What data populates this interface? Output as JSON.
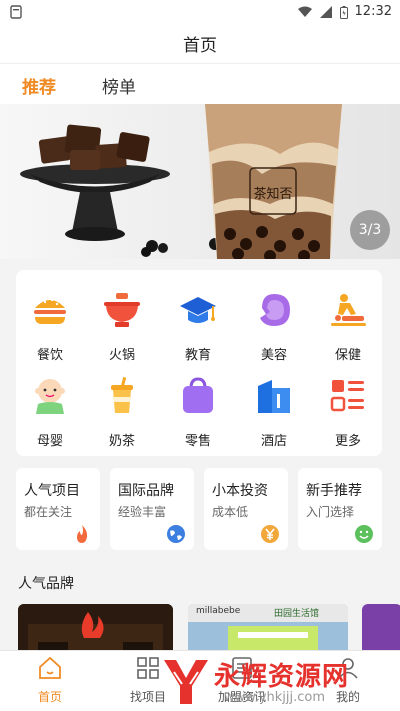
{
  "status_bar": {
    "time": "12:32"
  },
  "header": {
    "title": "首页"
  },
  "tabs": [
    {
      "label": "推荐"
    },
    {
      "label": "榜单"
    }
  ],
  "banner": {
    "pager": "3/3",
    "cup_text": "茶知否"
  },
  "categories": [
    {
      "label": "餐饮",
      "icon": "burger-icon"
    },
    {
      "label": "火锅",
      "icon": "hotpot-icon"
    },
    {
      "label": "教育",
      "icon": "graduation-cap-icon"
    },
    {
      "label": "美容",
      "icon": "beauty-face-icon"
    },
    {
      "label": "保健",
      "icon": "massage-icon"
    },
    {
      "label": "母婴",
      "icon": "baby-icon"
    },
    {
      "label": "奶茶",
      "icon": "milk-tea-icon"
    },
    {
      "label": "零售",
      "icon": "shopping-bag-icon"
    },
    {
      "label": "酒店",
      "icon": "hotel-building-icon"
    },
    {
      "label": "更多",
      "icon": "more-list-icon"
    }
  ],
  "cards": [
    {
      "title": "人气项目",
      "subtitle": "都在关注",
      "icon": "flame-icon",
      "color": "#f36a3c"
    },
    {
      "title": "国际品牌",
      "subtitle": "经验丰富",
      "icon": "globe-icon",
      "color": "#3b7fe0"
    },
    {
      "title": "小本投资",
      "subtitle": "成本低",
      "icon": "yen-icon",
      "color": "#f2a73a"
    },
    {
      "title": "新手推荐",
      "subtitle": "入门选择",
      "icon": "smile-icon",
      "color": "#5cc05c"
    }
  ],
  "section": {
    "title": "人气品牌"
  },
  "brands": [
    {
      "label": "millabebe"
    },
    {
      "label": "田园生活馆"
    }
  ],
  "bottom_nav": [
    {
      "label": "首页",
      "icon": "home-icon"
    },
    {
      "label": "找项目",
      "icon": "grid-icon"
    },
    {
      "label": "加盟资讯",
      "icon": "news-icon"
    },
    {
      "label": "我的",
      "icon": "user-icon"
    }
  ],
  "watermark": {
    "text": "永辉资源网",
    "url": "www.yhkjjj.com"
  },
  "colors": {
    "accent": "#f08a24"
  }
}
